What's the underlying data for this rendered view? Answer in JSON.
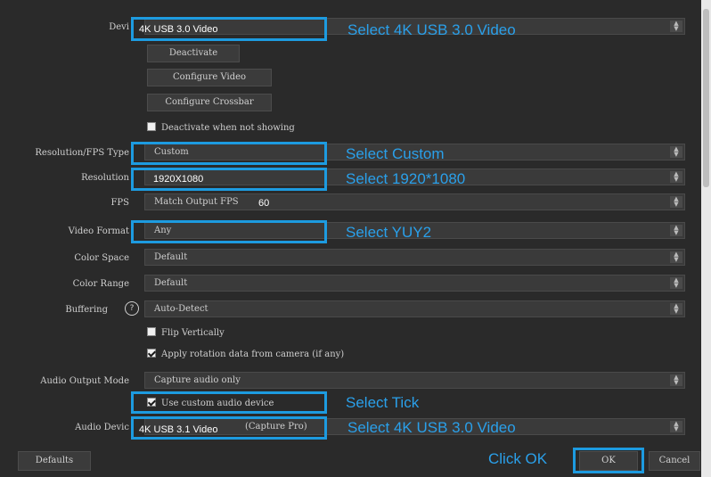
{
  "device_row": {
    "label": "Devi",
    "value": "4K USB 3.0 Video",
    "annotation": "Select 4K USB 3.0 Video"
  },
  "buttons": {
    "deactivate": "Deactivate",
    "configure_video": "Configure Video",
    "configure_crossbar": "Configure Crossbar",
    "defaults": "Defaults",
    "ok": "OK",
    "cancel": "Cancel"
  },
  "checkboxes": {
    "deactivate_not_showing": "Deactivate when not showing",
    "flip_vertically": "Flip Vertically",
    "apply_rotation": "Apply rotation data from camera (if any)",
    "use_custom_audio": "Use custom audio device"
  },
  "rows": {
    "resolution_fps_type": {
      "label": "Resolution/FPS Type",
      "value": "Custom",
      "annotation": "Select Custom"
    },
    "resolution": {
      "label": "Resolution",
      "value": "1920X1080",
      "annotation": "Select 1920*1080"
    },
    "fps": {
      "label": "FPS",
      "value": "Match Output FPS",
      "extra": "60"
    },
    "video_format": {
      "label": "Video Format",
      "value": "Any",
      "annotation": "Select YUY2"
    },
    "color_space": {
      "label": "Color Space",
      "value": "Default"
    },
    "color_range": {
      "label": "Color Range",
      "value": "Default"
    },
    "buffering": {
      "label": "Buffering",
      "value": "Auto-Detect",
      "help_glyph": "?"
    },
    "audio_output_mode": {
      "label": "Audio Output Mode",
      "value": "Capture audio only"
    },
    "audio_device": {
      "label": "Audio Devic",
      "value": "4K USB 3.1 Video",
      "suffix": "(Capture Pro)",
      "annotation": "Select 4K USB 3.0 Video"
    }
  },
  "annotations": {
    "tick": "Select Tick",
    "click_ok": "Click OK"
  },
  "colors": {
    "annotation_blue": "#1d9be0",
    "window_bg": "#2a2a2a"
  }
}
